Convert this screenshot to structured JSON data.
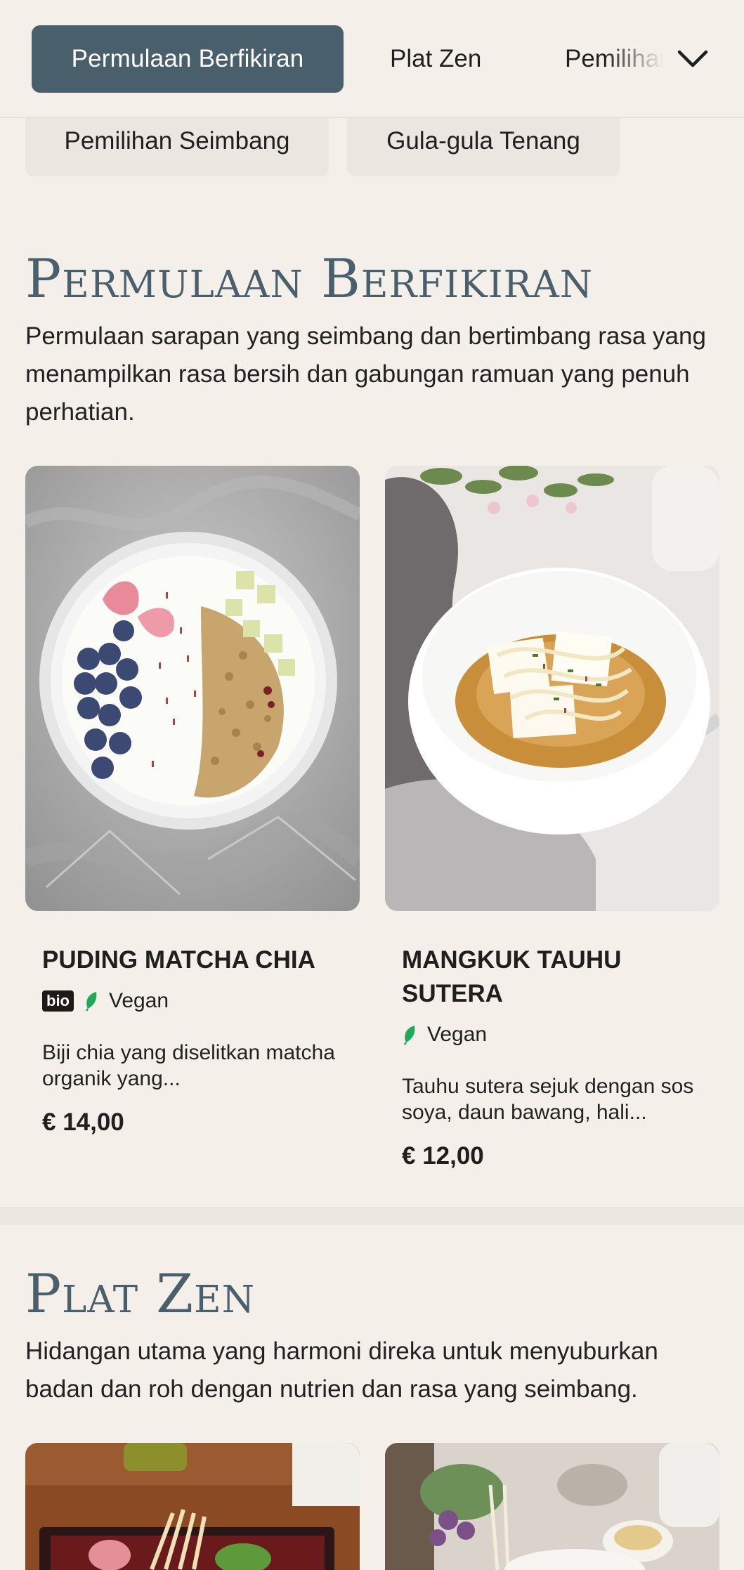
{
  "nav": {
    "tabs": [
      {
        "label": "Permulaan Berfikiran",
        "active": true
      },
      {
        "label": "Plat Zen",
        "active": false
      },
      {
        "label": "Pemilihan Seimbang",
        "active": false
      }
    ],
    "chips": [
      "Pemilihan Seimbang",
      "Gula-gula Tenang"
    ],
    "expand_icon": "chevron-down-icon"
  },
  "sections": [
    {
      "title": "Permulaan Berfikiran",
      "description": "Permulaan sarapan yang seimbang dan bertimbang rasa yang menampilkan rasa bersih dan gabungan ramuan yang penuh perhatian.",
      "items": [
        {
          "name": "Puding Matcha Chia",
          "badge": "bio",
          "tag": "Vegan",
          "description": "Biji chia yang diselitkan matcha organik yang...",
          "price": "€ 14,00"
        },
        {
          "name": "Mangkuk Tauhu Sutera",
          "tag": "Vegan",
          "description": "Tauhu sutera sejuk dengan sos soya, daun bawang, hali...",
          "price": "€ 12,00"
        }
      ]
    },
    {
      "title": "Plat Zen",
      "description": "Hidangan utama yang harmoni direka untuk menyuburkan badan dan roh dengan nutrien dan rasa yang seimbang."
    }
  ],
  "colors": {
    "background": "#f5efea",
    "accent": "#4a5f6c",
    "vegan_leaf": "#1faa5a"
  }
}
